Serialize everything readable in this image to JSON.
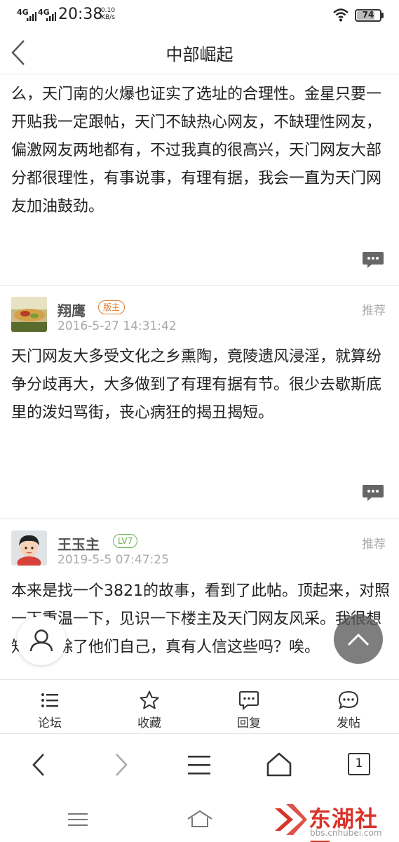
{
  "status_bar": {
    "network_1": "4G",
    "network_2": "4G",
    "time": "20:38",
    "speed_value": "0.10",
    "speed_unit": "KB/s",
    "battery": "74",
    "battery_level": 0.74
  },
  "header": {
    "title": "中部崛起"
  },
  "posts": [
    {
      "body": "么，天门南的火爆也证实了选址的合理性。金星只要一开贴我一定跟帖，天门不缺热心网友，不缺理性网友，偏激网友两地都有，不过我真的很高兴，天门网友大部分都很理性，有事说事，有理有据，我会一直为天门网友加油鼓劲。"
    },
    {
      "author": "翔鹰",
      "badge": "版主",
      "time": "2016-5-27 14:31:42",
      "recommend": "推荐",
      "body": "天门网友大多受文化之乡熏陶，竟陵遗风浸淫，就算纷争分歧再大，大多做到了有理有据有节。很少去歇斯底里的泼妇骂街，丧心病狂的揭丑揭短。"
    },
    {
      "author": "王玉主",
      "badge": "LV7",
      "time": "2019-5-5 07:47:25",
      "recommend": "推荐",
      "body": "本来是找一个3821的故事，看到了此帖。顶起来，对照一下重温一下，见识一下楼主及天门网友风采。我很想知道，除了他们自己，真有人信这些吗？唉。"
    }
  ],
  "tabs": [
    {
      "label": "论坛",
      "icon": "list-icon"
    },
    {
      "label": "收藏",
      "icon": "star-icon"
    },
    {
      "label": "回复",
      "icon": "comment-icon"
    },
    {
      "label": "发帖",
      "icon": "chat-icon"
    }
  ],
  "browser_nav": {
    "tab_count": "1"
  },
  "watermark": {
    "name": "东湖社区",
    "url": "bbs.cnhubei.com"
  },
  "colors": {
    "accent_red": "#d8342a",
    "moderator_badge": "#e07a2e",
    "level_badge": "#6ab04c",
    "muted_text": "#aaaaaa"
  }
}
